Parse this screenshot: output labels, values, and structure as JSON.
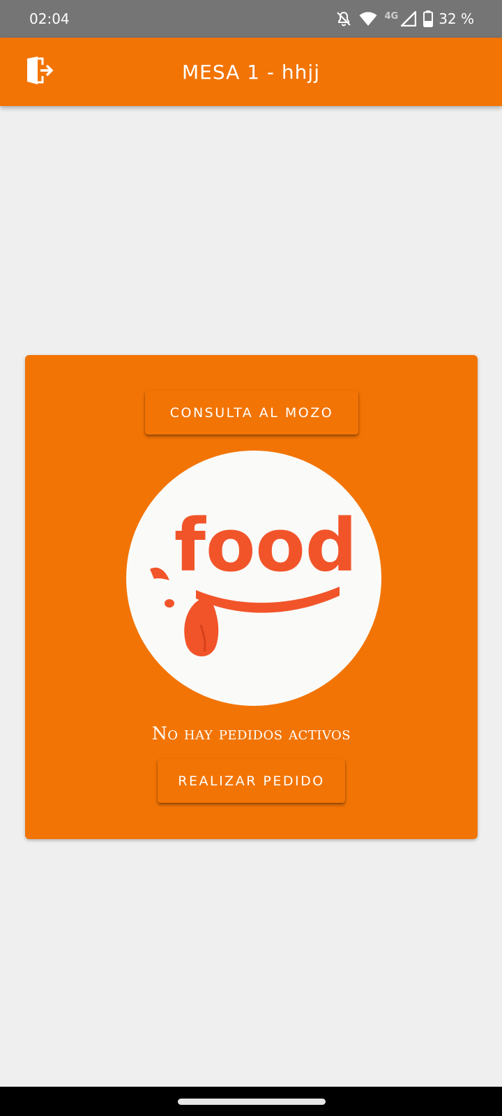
{
  "status_bar": {
    "time": "02:04",
    "network_label": "4G",
    "battery_percent": "32 %",
    "icons": [
      "notifications-off-icon",
      "wifi-icon",
      "cell-signal-icon",
      "battery-icon"
    ]
  },
  "app_bar": {
    "title": "MESA 1 - hhjj",
    "exit_icon": "exit-door-icon"
  },
  "card": {
    "consulta_button_label": "CONSULTA AL MOZO",
    "logo_text": "food",
    "status_text": "No hay pedidos activos",
    "pedido_button_label": "REALIZAR PEDIDO"
  },
  "colors": {
    "primary": "#f27405",
    "background": "#efefef",
    "logo_red": "#f2542a",
    "status_bar": "#757575"
  }
}
